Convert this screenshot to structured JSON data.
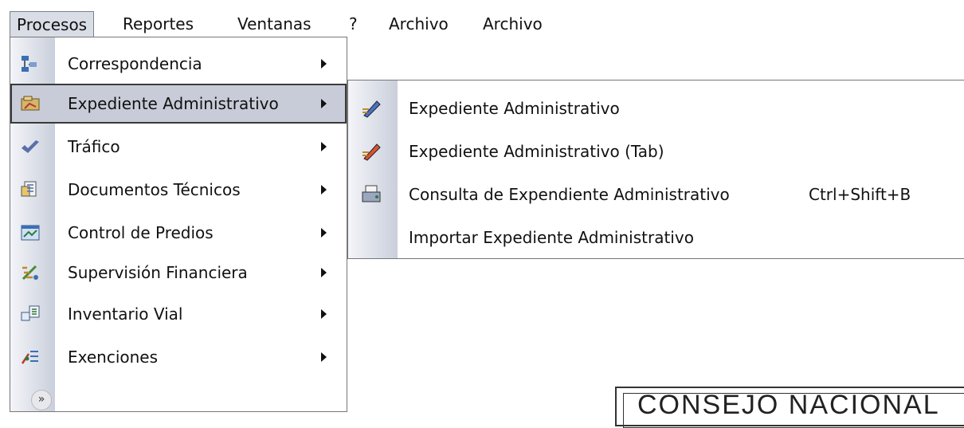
{
  "menubar": {
    "items": [
      {
        "label": "Procesos",
        "active": true
      },
      {
        "label": "Reportes",
        "active": false
      },
      {
        "label": "Ventanas",
        "active": false
      },
      {
        "label": "?",
        "active": false
      },
      {
        "label": "Archivo",
        "active": false
      },
      {
        "label": "Archivo",
        "active": false
      }
    ]
  },
  "procesos_menu": {
    "items": [
      {
        "label": "Correspondencia",
        "icon": "correspondence-icon",
        "has_submenu": true
      },
      {
        "label": "Expediente Administrativo",
        "icon": "folder-hand-icon",
        "has_submenu": true,
        "selected": true
      },
      {
        "label": "Tráfico",
        "icon": "traffic-check-icon",
        "has_submenu": true
      },
      {
        "label": "Documentos Técnicos",
        "icon": "technical-docs-icon",
        "has_submenu": true
      },
      {
        "label": "Control de Predios",
        "icon": "property-window-icon",
        "has_submenu": true
      },
      {
        "label": "Supervisión Financiera",
        "icon": "financial-supervision-icon",
        "has_submenu": true
      },
      {
        "label": "Inventario Vial",
        "icon": "road-inventory-icon",
        "has_submenu": true
      },
      {
        "label": "Exenciones",
        "icon": "exemptions-icon",
        "has_submenu": true
      }
    ],
    "more_glyph": "»"
  },
  "expediente_submenu": {
    "items": [
      {
        "label": "Expediente Administrativo",
        "icon": "pencil-blue-icon",
        "shortcut": ""
      },
      {
        "label": "Expediente Administrativo (Tab)",
        "icon": "pencil-red-icon",
        "shortcut": ""
      },
      {
        "label": "Consulta de Expendiente Administrativo",
        "icon": "consult-printer-icon",
        "shortcut": "Ctrl+Shift+B"
      },
      {
        "label": "Importar Expediente Administrativo",
        "icon": "",
        "shortcut": ""
      }
    ]
  },
  "background_sign": {
    "text": "CONSEJO NACIONAL"
  },
  "colors": {
    "menu_highlight": "#c7ccd8",
    "icon_column_gradient_end": "#c9cfdb"
  }
}
